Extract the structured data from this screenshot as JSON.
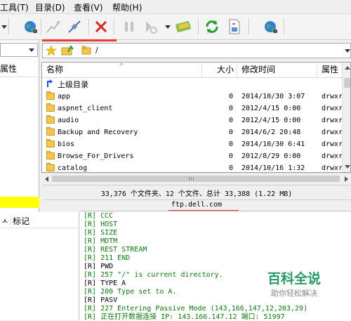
{
  "menu": [
    "工具(T)",
    "目录(D)",
    "查看(V)",
    "帮助(H)"
  ],
  "left_pane": {
    "header": "属性",
    "bottom_cols": [
      "ㅅ",
      "标记"
    ]
  },
  "address": {
    "path": "/"
  },
  "file_list": {
    "columns": [
      "名称",
      "大小",
      "修改时间",
      "属性"
    ],
    "up_label": "上级目录",
    "rows": [
      {
        "name": "app",
        "size": "0",
        "date": "2014/10/30 3:07",
        "attr": "drwxrw"
      },
      {
        "name": "aspnet_client",
        "size": "0",
        "date": "2012/4/15 0:00",
        "attr": "drwxrw"
      },
      {
        "name": "audio",
        "size": "0",
        "date": "2012/4/15 0:00",
        "attr": "drwxrw"
      },
      {
        "name": "Backup and Recovery",
        "size": "0",
        "date": "2014/6/2 20:48",
        "attr": "drwxrw"
      },
      {
        "name": "bios",
        "size": "0",
        "date": "2014/10/30 6:41",
        "attr": "drwxrw"
      },
      {
        "name": "Browse_For_Drivers",
        "size": "0",
        "date": "2012/8/29 0:00",
        "attr": "drwxrw"
      },
      {
        "name": "catalog",
        "size": "0",
        "date": "2014/10/16 1:32",
        "attr": "drwxrw"
      }
    ]
  },
  "status": {
    "summary": "33,376 个文件夹、12 个文件、总计 33,388 (1.22 MB)",
    "host": "ftp.dell.com"
  },
  "log": [
    {
      "text": "[R]  CCC",
      "color": "green"
    },
    {
      "text": "[R]  HOST",
      "color": "green"
    },
    {
      "text": "[R]  SIZE",
      "color": "green"
    },
    {
      "text": "[R]  MDTM",
      "color": "green"
    },
    {
      "text": "[R]  REST STREAM",
      "color": "green"
    },
    {
      "text": "[R] 211 END",
      "color": "green"
    },
    {
      "text": "[R] PWD",
      "color": "black"
    },
    {
      "text": "[R] 257 \"/\" is current directory.",
      "color": "green"
    },
    {
      "text": "[R] TYPE A",
      "color": "black"
    },
    {
      "text": "[R] 200 Type set to A.",
      "color": "green"
    },
    {
      "text": "[R] PASV",
      "color": "black"
    },
    {
      "text": "[R] 227 Entering Passive Mode (143,166,147,12,203,29)",
      "color": "green"
    },
    {
      "text": "[R] 正在打开数据连接 IP: 143.166.147.12 端口: 51997",
      "color": "green"
    }
  ],
  "watermark": {
    "title": "百科全说",
    "subtitle": "助你轻松解决"
  },
  "colors": {
    "accent_red": "#f03838",
    "log_green": "#0a7a0a",
    "highlight_yellow": "#ffff00"
  }
}
